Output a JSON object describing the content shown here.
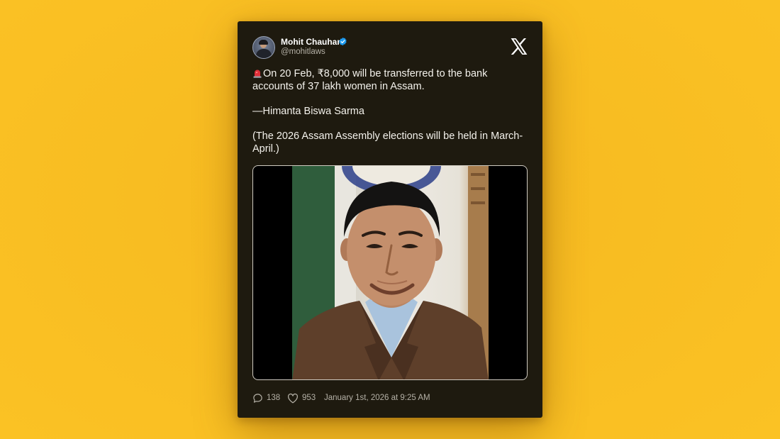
{
  "tweet": {
    "author": {
      "name": "Mohit Chauhan",
      "handle": "@mohitlaws",
      "verified": true
    },
    "body": {
      "line1": "On 20 Feb, ₹8,000 will be transferred to the bank accounts of 37 lakh women in Assam.",
      "line2": "—Himanta Biswa Sarma",
      "line3": "(The 2026 Assam Assembly elections will be held in March-April.)"
    },
    "stats": {
      "replies": "138",
      "likes": "953",
      "timestamp": "January 1st, 2026 at 9:25 AM"
    }
  },
  "icons": {
    "platform": "x-logo-icon",
    "verified": "verified-badge-icon",
    "emoji": "police-siren-icon",
    "reply": "reply-icon",
    "like": "heart-icon"
  },
  "colors": {
    "background": "#fbbf24",
    "card": "#1e1a0f",
    "verified": "#1d9bf0",
    "text": "#f4f2ec",
    "muted": "#b4b0a6"
  }
}
